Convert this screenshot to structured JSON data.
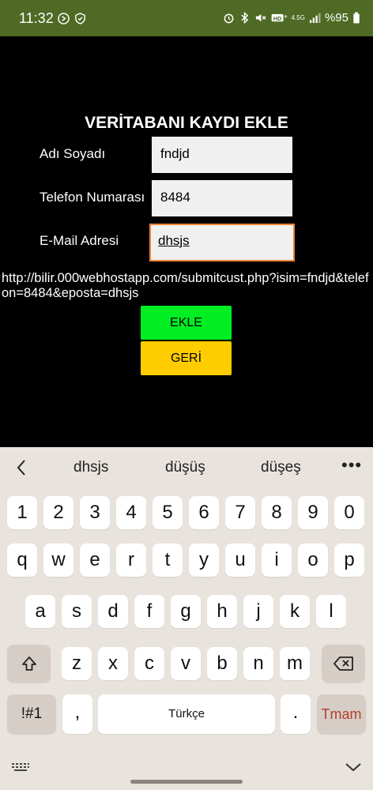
{
  "status_bar": {
    "time": "11:32",
    "battery": "%95",
    "network": "4.5G"
  },
  "form": {
    "title": "VERİTABANI KAYDI EKLE",
    "fields": [
      {
        "label": "Adı Soyadı",
        "value": "fndjd"
      },
      {
        "label": "Telefon Numarası",
        "value": "8484"
      },
      {
        "label": "E-Mail Adresi",
        "value": "dhsjs"
      }
    ],
    "url": "http://bilir.000webhostapp.com/submitcust.php?isim=fndjd&telefon=8484&eposta=dhsjs",
    "add_button": "EKLE",
    "back_button": "GERİ",
    "colors": {
      "add": "#00ee22",
      "back": "#ffcc00",
      "focus": "#ee8232"
    }
  },
  "keyboard": {
    "suggestions": [
      "dhsjs",
      "düşüş",
      "düşeş"
    ],
    "row_numbers": [
      "1",
      "2",
      "3",
      "4",
      "5",
      "6",
      "7",
      "8",
      "9",
      "0"
    ],
    "row_1": [
      "q",
      "w",
      "e",
      "r",
      "t",
      "y",
      "u",
      "i",
      "o",
      "p"
    ],
    "row_2": [
      "a",
      "s",
      "d",
      "f",
      "g",
      "h",
      "j",
      "k",
      "l"
    ],
    "row_3": [
      "z",
      "x",
      "c",
      "v",
      "b",
      "n",
      "m"
    ],
    "symbols_key": "!#1",
    "comma_key": ",",
    "space_label": "Türkçe",
    "period_key": ".",
    "done_key": "Tmam"
  }
}
